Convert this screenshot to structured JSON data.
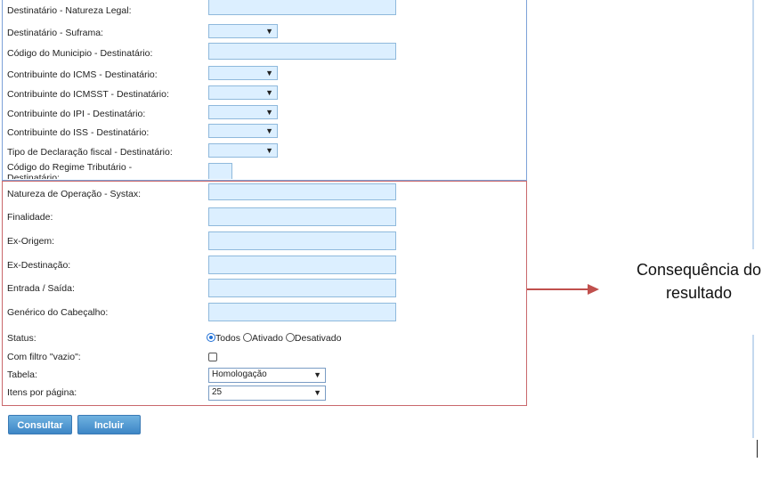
{
  "fields_destinatario": [
    {
      "label": "Destinatário - Natureza Legal:",
      "type": "text",
      "value": ""
    },
    {
      "label": "Destinatário - Suframa:",
      "type": "select",
      "value": ""
    },
    {
      "label": "Código do Municipio - Destinatário:",
      "type": "text",
      "value": ""
    },
    {
      "label": "Contribuinte do ICMS - Destinatário:",
      "type": "select",
      "value": ""
    },
    {
      "label": "Contribuinte do ICMSST - Destinatário:",
      "type": "select",
      "value": ""
    },
    {
      "label": "Contribuinte do IPI - Destinatário:",
      "type": "select",
      "value": ""
    },
    {
      "label": "Contribuinte do ISS - Destinatário:",
      "type": "select",
      "value": ""
    },
    {
      "label": "Tipo de Declaração fiscal - Destinatário:",
      "type": "select",
      "value": ""
    },
    {
      "label": "Código do Regime Tributário - Destinatário:",
      "type": "small",
      "value": ""
    }
  ],
  "fields_resultado": [
    {
      "label": "Natureza de Operação - Systax:",
      "value": ""
    },
    {
      "label": "Finalidade:",
      "value": ""
    },
    {
      "label": "Ex-Origem:",
      "value": ""
    },
    {
      "label": "Ex-Destinação:",
      "value": ""
    },
    {
      "label": "Entrada / Saída:",
      "value": ""
    },
    {
      "label": "Genérico do Cabeçalho:",
      "value": ""
    }
  ],
  "status": {
    "label": "Status:",
    "options": [
      "Todos",
      "Ativado",
      "Desativado"
    ],
    "selected": "Todos"
  },
  "filtro_vazio": {
    "label": "Com filtro \"vazio\":",
    "checked": false
  },
  "tabela": {
    "label": "Tabela:",
    "value": "Homologação"
  },
  "itens_por_pagina": {
    "label": "Itens por página:",
    "value": "25"
  },
  "buttons": {
    "consultar": "Consultar",
    "incluir": "Incluir"
  },
  "annotation": {
    "text_line1": "Consequência do",
    "text_line2": "resultado",
    "color": "#c0504d"
  },
  "colors": {
    "blue_frame": "#7da2d8",
    "red_frame": "#c9686c",
    "input_bg": "#dcefff"
  }
}
